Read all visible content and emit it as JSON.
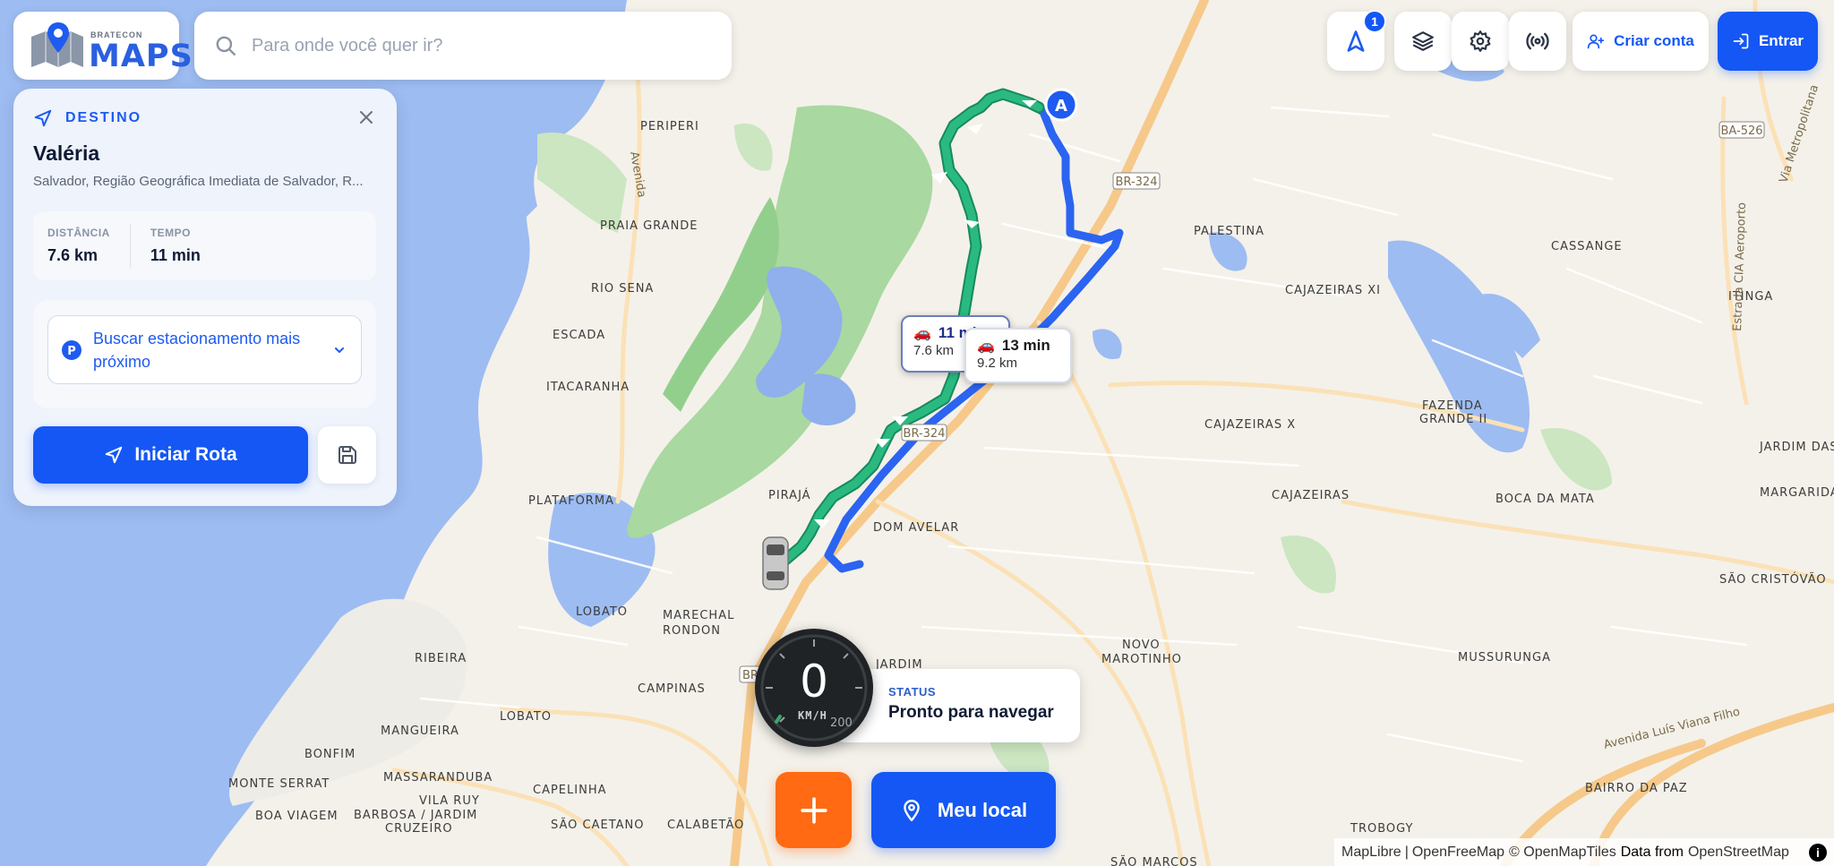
{
  "app": {
    "logo_small": "BRATECON",
    "logo_big": "MAPS"
  },
  "search": {
    "placeholder": "Para onde você quer ir?",
    "value": ""
  },
  "destination": {
    "header": "DESTINO",
    "name": "Valéria",
    "address": "Salvador, Região Geográfica Imediata de Salvador, R...",
    "distance_label": "DISTÂNCIA",
    "distance_value": "7.6 km",
    "time_label": "TEMPO",
    "time_value": "11 min",
    "parking_label": "Buscar estacionamento mais próximo",
    "start_label": "Iniciar Rota"
  },
  "toolbar": {
    "nav_badge": "1",
    "criar_label": "Criar conta",
    "entrar_label": "Entrar"
  },
  "routes": [
    {
      "time": "11 min",
      "distance": "7.6 km",
      "color": "#1f9d6e"
    },
    {
      "time": "13 min",
      "distance": "9.2 km",
      "color": "#2b64f0"
    }
  ],
  "speed": {
    "value": "0",
    "unit": "KM/H",
    "max": "200",
    "status_label": "STATUS",
    "status_text": "Pronto para navegar"
  },
  "bottom": {
    "local_label": "Meu local"
  },
  "map_labels": {
    "places": [
      "PERIPERI",
      "PRAIA GRANDE",
      "RIO SENA",
      "ESCADA",
      "ITACARANHA",
      "PLATAFORMA",
      "PIRAJÁ",
      "DOM AVELAR",
      "MARECHAL",
      "RONDON",
      "LOBATO",
      "RIBEIRA",
      "CAMPINAS",
      "LOBATO",
      "BONFIM",
      "MANGUEIRA",
      "MONTE SERRAT",
      "MASSARANDUBA",
      "VILA RUY",
      "BARBOSA / JARDIM",
      "BOA VIAGEM",
      "CRUZEIRO",
      "CAPELINHA",
      "SÃO CAETANO",
      "CALABETÃO",
      "JARDIM",
      "NOVO",
      "MAROTINHO",
      "PALESTINA",
      "CAJAZEIRAS XI",
      "CASSANGE",
      "ITINGA",
      "FAZENDA",
      "GRANDE II",
      "CAJAZEIRAS X",
      "CAJAZEIRAS",
      "BOCA DA MATA",
      "JARDIM DAS",
      "MARGARIDAS",
      "SÃO CRISTÓVÃO",
      "MUSSURUNGA",
      "BAIRRO DA PAZ",
      "TROBOGY",
      "SÃO MARCOS"
    ],
    "roads": [
      "BR-324",
      "BR-324",
      "BA-526",
      "BR",
      "Avenida Luís Viana Filho",
      "Estrada CIA Aeroporto",
      "Via Metropolitana",
      "Avenida"
    ]
  },
  "attribution": {
    "maplibre": "MapLibre",
    "openfreemap": "OpenFreeMap",
    "copy": "© OpenMapTiles",
    "data_from": "Data from",
    "osm": "OpenStreetMap"
  },
  "colors": {
    "primary": "#1457f5",
    "accent_orange": "#ff6a13",
    "route_primary": "#1f9d6e",
    "route_alt": "#2b64f0",
    "water": "#9dbcf2",
    "park": "#a9d8a0"
  }
}
